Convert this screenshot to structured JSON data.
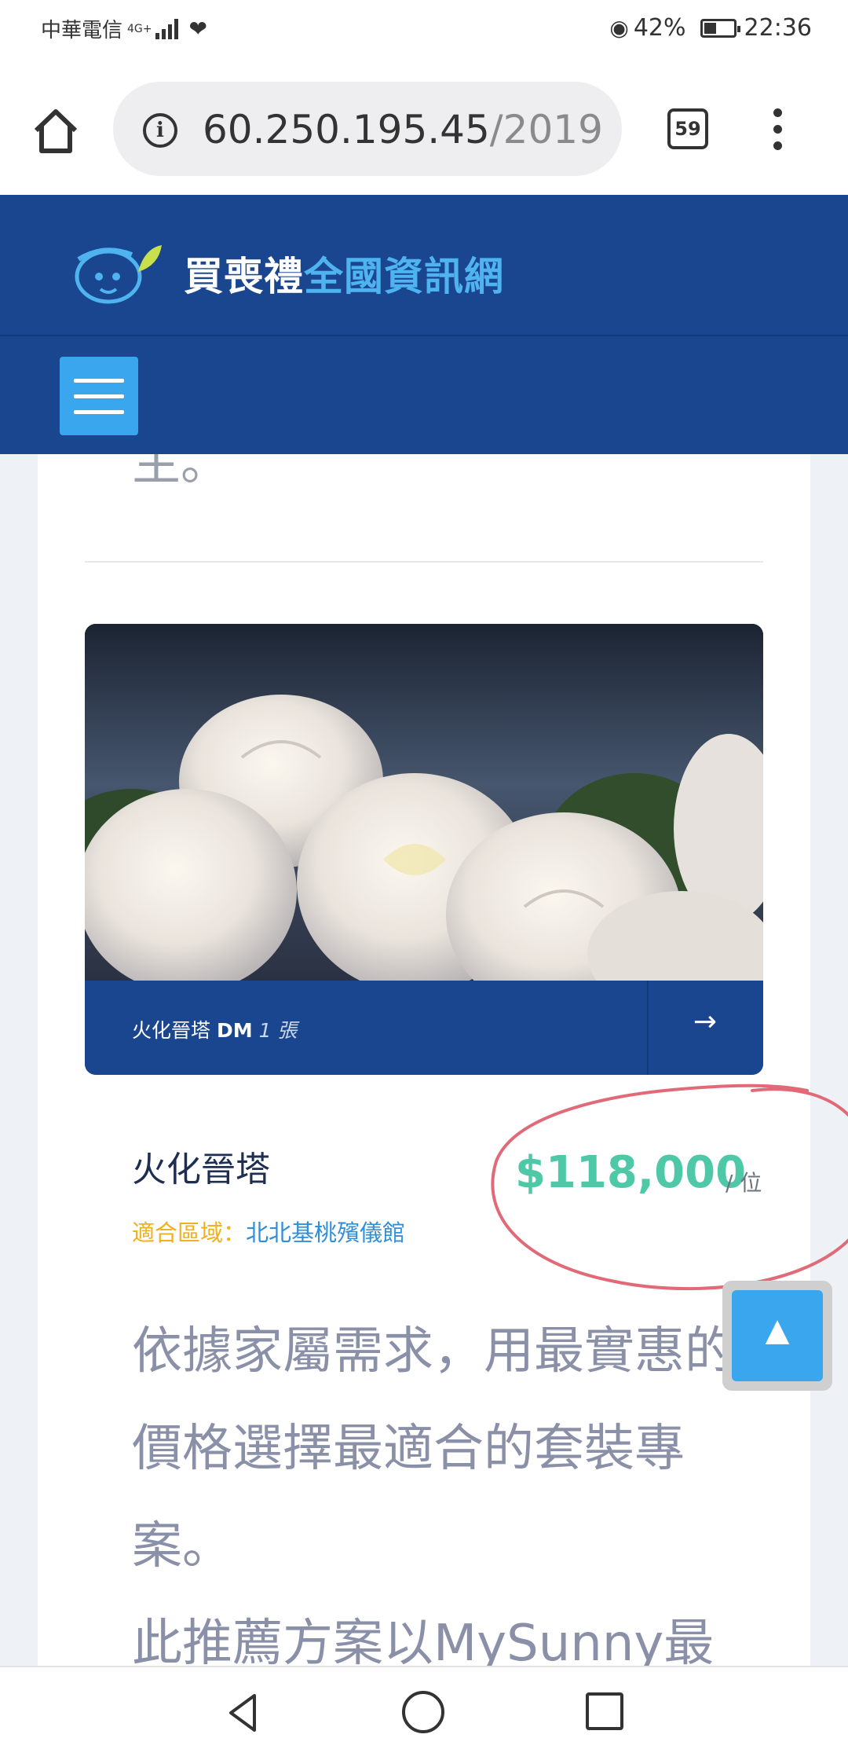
{
  "status_bar": {
    "carrier": "中華電信",
    "network": "4G+",
    "battery_percent": "42%",
    "battery_level": 0.42,
    "time": "22:36"
  },
  "browser": {
    "url_host": "60.250.195.45",
    "url_path": "/2019",
    "tab_count": "59"
  },
  "header": {
    "logo_text_a": "買喪禮",
    "logo_text_b": "全國資訊網",
    "colors": {
      "header_bg": "#1a4690",
      "accent": "#3aa6ee",
      "logo_b": "#4fb3f0"
    }
  },
  "content": {
    "prev_text_tail": "主。",
    "image_card": {
      "label_prefix": "火化晉塔",
      "label_dm": "DM",
      "label_count": "1 張",
      "arrow": "→"
    },
    "product": {
      "title": "火化晉塔",
      "region_label": "適合區域：",
      "region_value": "北北基桃殯儀館",
      "price": "$118,000",
      "unit": "/ 位",
      "price_color": "#4ec8a6"
    },
    "description": [
      "依據家屬需求，用最實惠的價格選擇最適合的套裝專案。",
      "此推薦方案以MySunny最"
    ],
    "back_to_top": "▲"
  },
  "icons": {
    "home": "home-icon",
    "info": "info-icon",
    "menu": "more-vert-icon",
    "hamburger": "hamburger-menu-icon",
    "nav_back": "back-triangle-icon",
    "nav_home": "home-circle-icon",
    "nav_recent": "recent-apps-square-icon"
  }
}
